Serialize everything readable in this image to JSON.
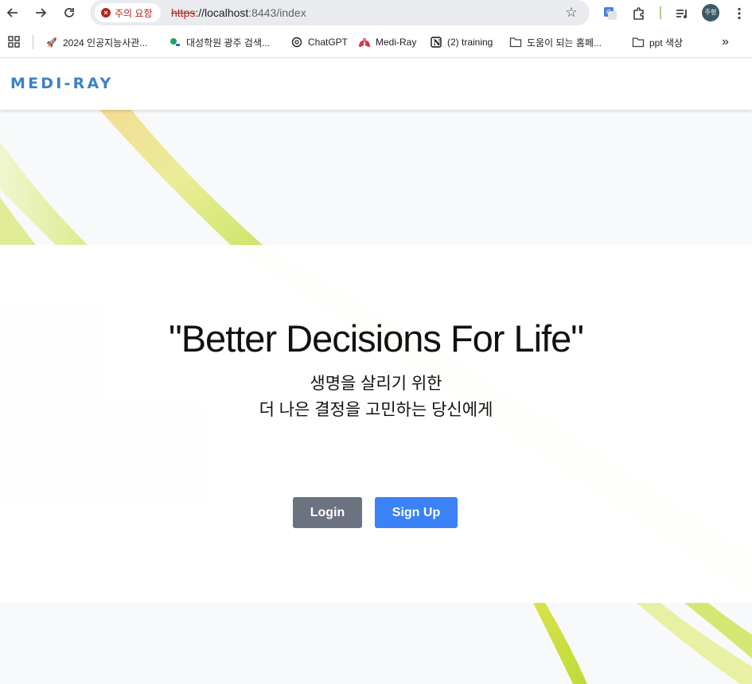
{
  "browser": {
    "security_chip": "주의 요함",
    "url_scheme": "https",
    "url_rest_host": "://localhost",
    "url_rest_path": ":8443/index",
    "profile_initials": "주형",
    "icons": [
      "back-arrow-icon",
      "forward-arrow-icon",
      "reload-icon",
      "bookmark-star-icon",
      "google-translate-icon",
      "extensions-puzzle-icon",
      "media-queue-icon",
      "kebab-menu-icon"
    ]
  },
  "bookmarks": [
    {
      "label": "2024 인공지능사관...",
      "icon": "rocket-icon"
    },
    {
      "label": "대성학원 광주 검색...",
      "icon": "leaf-icon"
    },
    {
      "label": "ChatGPT",
      "icon": "openai-icon"
    },
    {
      "label": "Medi-Ray",
      "icon": "lungs-icon"
    },
    {
      "label": "(2) training",
      "icon": "notion-icon"
    },
    {
      "label": "도움이 되는 홈페...",
      "icon": "folder-icon"
    },
    {
      "label": "ppt 색상",
      "icon": "folder-icon"
    }
  ],
  "site": {
    "logo": "MEDI-RAY",
    "hero_title": "\"Better Decisions For Life\"",
    "hero_sub_line1": "생명을 살리기 위한",
    "hero_sub_line2": "더 나은 결정을 고민하는 당신에게",
    "login_label": "Login",
    "signup_label": "Sign Up"
  },
  "colors": {
    "logo": "#3b82c4",
    "login_button": "#6b7280",
    "signup_button": "#3b82f6",
    "ribbon_yellow": "#e3ea8a",
    "ribbon_green": "#cfe45a"
  }
}
